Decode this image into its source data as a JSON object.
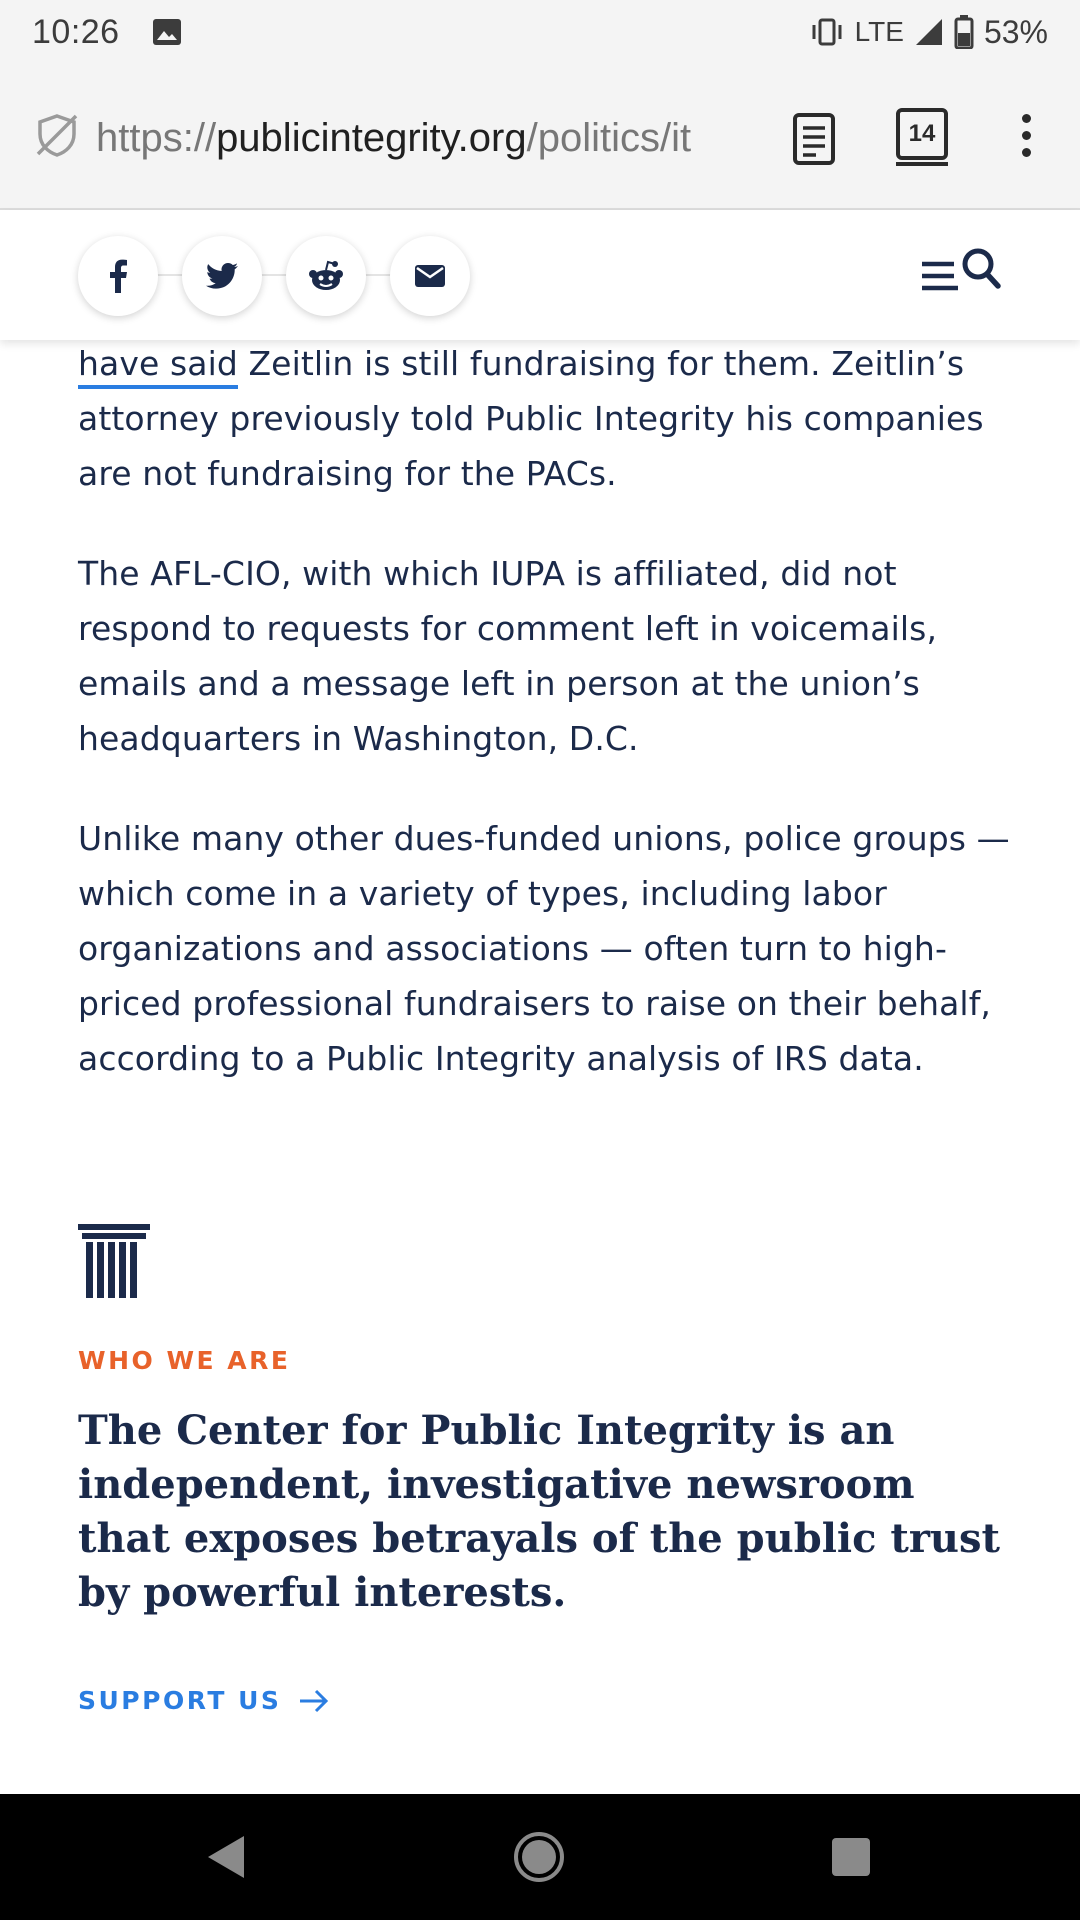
{
  "status_bar": {
    "time": "10:26",
    "network": "LTE",
    "battery": "53%",
    "icons": [
      "image-notification-icon",
      "vibrate-icon",
      "signal-icon",
      "battery-icon"
    ]
  },
  "browser": {
    "url_scheme": "https://",
    "url_host": "publicintegrity.org",
    "url_path": "/politics/it",
    "tab_count": "14",
    "icons": [
      "site-shield-icon",
      "reader-mode-icon",
      "overflow-menu-icon"
    ]
  },
  "share_bar": {
    "buttons": [
      "facebook-icon",
      "twitter-icon",
      "reddit-icon",
      "email-icon"
    ],
    "menu_icon": "menu-search-icon"
  },
  "article": {
    "p1_link": "have said",
    "p1_rest": " Zeitlin is still fundraising for them. Zeitlin’s attorney previously told Public Integrity his companies are not fundraising for the PACs.",
    "p2": "The AFL-CIO, with which IUPA is affiliated, did not respond to requests for comment left in voicemails, emails and a message left in person at the union’s headquarters in Washington, D.C.",
    "p3": "Unlike many other dues-funded unions, police groups — which come in a variety of types, including labor organizations and associations — often turn to high-priced professional fundraisers to raise on their behalf, according to a Public Integrity analysis of IRS data."
  },
  "who_we_are": {
    "label": "WHO WE ARE",
    "statement": "The Center for Public Integrity is an independent, investigative newsroom that exposes betrayals of the public trust by powerful interests.",
    "support_label": "SUPPORT US",
    "icons": [
      "pillar-logo-icon",
      "arrow-right-icon"
    ]
  },
  "nav_bar": {
    "icons": [
      "back-icon",
      "home-icon",
      "recents-icon"
    ]
  },
  "colors": {
    "text": "#1b2a4a",
    "accent_orange": "#e8622a",
    "link_blue": "#2a7de1",
    "chrome_bg": "#f4f4f4"
  }
}
